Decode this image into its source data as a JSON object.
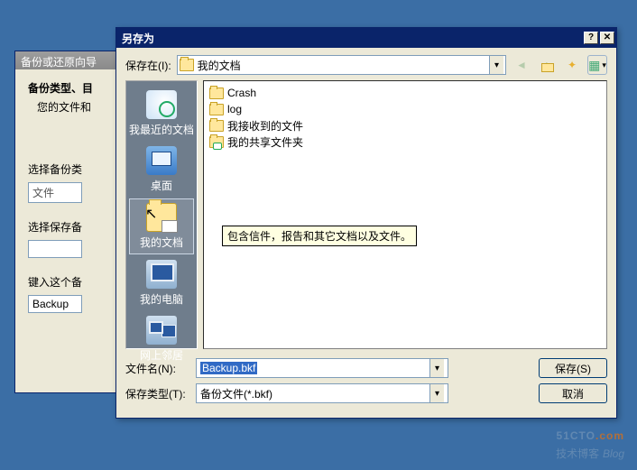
{
  "wizard": {
    "title": "备份或还原向导",
    "heading": "备份类型、目",
    "sub": "您的文件和",
    "group1_label": "选择备份类",
    "group1_value": "文件",
    "group2_label": "选择保存备",
    "group3_label": "键入这个备",
    "group3_value": "Backup"
  },
  "dialog": {
    "title": "另存为",
    "lookin_label": "保存在(I):",
    "lookin_value": "我的文档",
    "places": {
      "recent": "我最近的文档",
      "desktop": "桌面",
      "mydocs": "我的文档",
      "mypc": "我的电脑",
      "network": "网上邻居"
    },
    "files": [
      "Crash",
      "log",
      "我接收到的文件",
      "我的共享文件夹"
    ],
    "tooltip": "包含信件，报告和其它文档以及文件。",
    "filename_label": "文件名(N):",
    "filename_value": "Backup.bkf",
    "filetype_label": "保存类型(T):",
    "filetype_value": "备份文件(*.bkf)",
    "save_btn": "保存(S)",
    "cancel_btn": "取消"
  },
  "watermark": {
    "brand": "51CTO",
    "suffix": ".com",
    "sub": "技术博客",
    "blog": "Blog"
  }
}
